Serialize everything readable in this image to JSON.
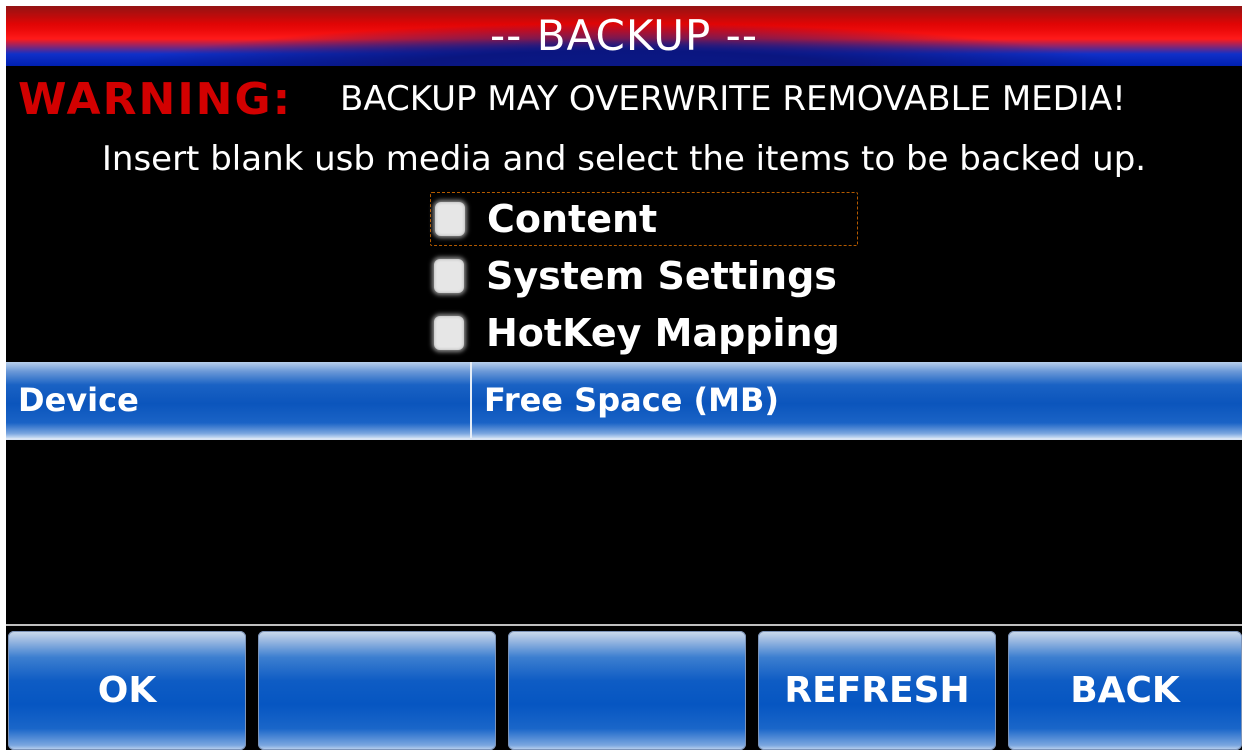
{
  "header": {
    "title": "-- BACKUP --"
  },
  "warning": {
    "label": "WARNING:",
    "text": "BACKUP MAY OVERWRITE REMOVABLE MEDIA!",
    "label_color": "#d20000"
  },
  "instructions": "Insert blank usb media and select the items to be backed up.",
  "options": [
    {
      "label": "Content",
      "checked": false,
      "focused": true
    },
    {
      "label": "System Settings",
      "checked": false,
      "focused": false
    },
    {
      "label": "HotKey Mapping",
      "checked": false,
      "focused": false
    }
  ],
  "table": {
    "columns": [
      "Device",
      "Free Space (MB)"
    ],
    "rows": []
  },
  "buttons": {
    "ok": "OK",
    "empty_1": "",
    "empty_2": "",
    "refresh": "REFRESH",
    "back": "BACK"
  },
  "colors": {
    "accent_blue": "#0656c2",
    "title_red": "#e00000",
    "background": "#000000"
  }
}
